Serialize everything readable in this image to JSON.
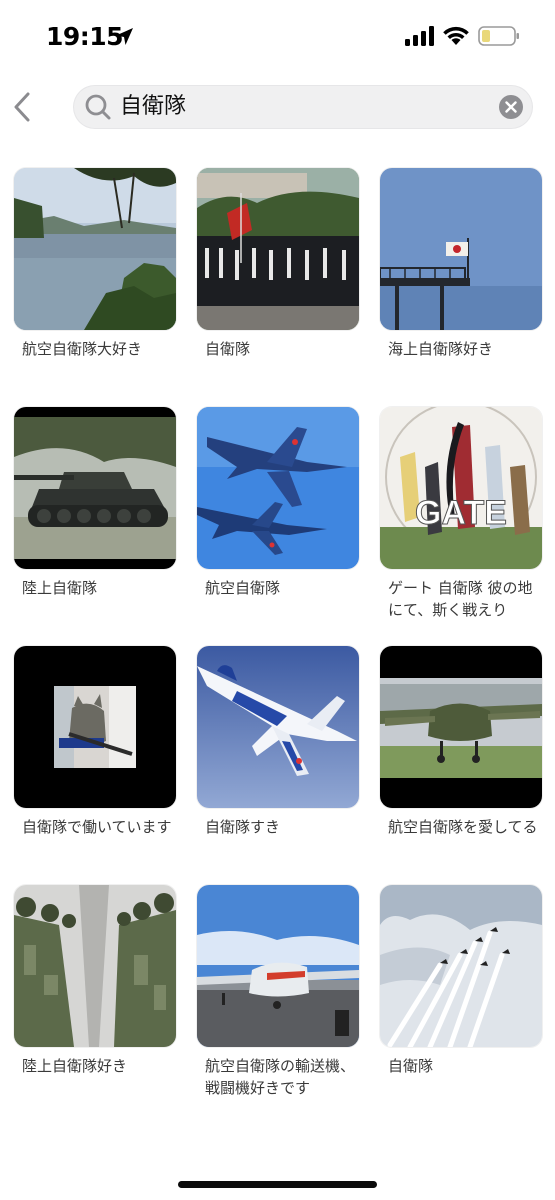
{
  "status_bar": {
    "time": "19:15"
  },
  "search": {
    "query": "自衛隊"
  },
  "results": [
    {
      "caption": "航空自衛隊大好き",
      "image": "lake-landscape"
    },
    {
      "caption": "自衛隊",
      "image": "marching-soldiers-parade"
    },
    {
      "caption": "海上自衛隊好き",
      "image": "pier-with-flag"
    },
    {
      "caption": "陸上自衛隊",
      "image": "tank"
    },
    {
      "caption": "航空自衛隊",
      "image": "fighter-jets"
    },
    {
      "caption": "ゲート 自衛隊 彼の地にて、斯く戦えり",
      "image": "anime-poster",
      "poster_text": "GATE"
    },
    {
      "caption": "自衛隊で働いています",
      "image": "cat-with-rifle"
    },
    {
      "caption": "自衛隊すき",
      "image": "blue-impulse-jet"
    },
    {
      "caption": "航空自衛隊を愛してる",
      "image": "transport-aircraft"
    },
    {
      "caption": "陸上自衛隊好き",
      "image": "soldiers-in-camouflage"
    },
    {
      "caption": "航空自衛隊の輸送機、戦闘機好きです",
      "image": "transport-plane-on-apron"
    },
    {
      "caption": "自衛隊",
      "image": "aerobatic-team-smoke-trails"
    }
  ]
}
